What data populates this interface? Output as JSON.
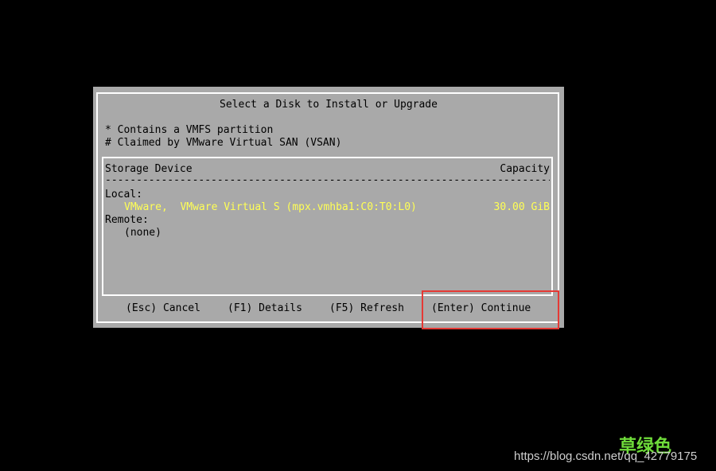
{
  "dialog": {
    "title": "Select a Disk to Install or Upgrade",
    "legend": [
      "* Contains a VMFS partition",
      "# Claimed by VMware Virtual SAN (VSAN)"
    ]
  },
  "list": {
    "header": {
      "device": "Storage Device",
      "capacity": "Capacity"
    },
    "separator": "------------------------------------------------------------------------",
    "groups": [
      {
        "label": "Local:",
        "items": [
          {
            "device": "VMware,  VMware Virtual S (mpx.vmhba1:C0:T0:L0)",
            "capacity": "30.00 GiB",
            "selected": true
          }
        ]
      },
      {
        "label": "Remote:",
        "items": [
          {
            "device": "(none)",
            "capacity": "",
            "selected": false
          }
        ]
      }
    ]
  },
  "footer": {
    "cancel": "(Esc) Cancel",
    "details": "(F1) Details",
    "refresh": "(F5) Refresh",
    "continue": "(Enter) Continue"
  },
  "watermark": {
    "chinese": "草绿色",
    "url": "https://blog.csdn.net/qq_42779175"
  },
  "colors": {
    "background": "#000000",
    "dialog": "#a9a9a9",
    "selected_text": "#ffff55",
    "highlight": "#e53935"
  }
}
